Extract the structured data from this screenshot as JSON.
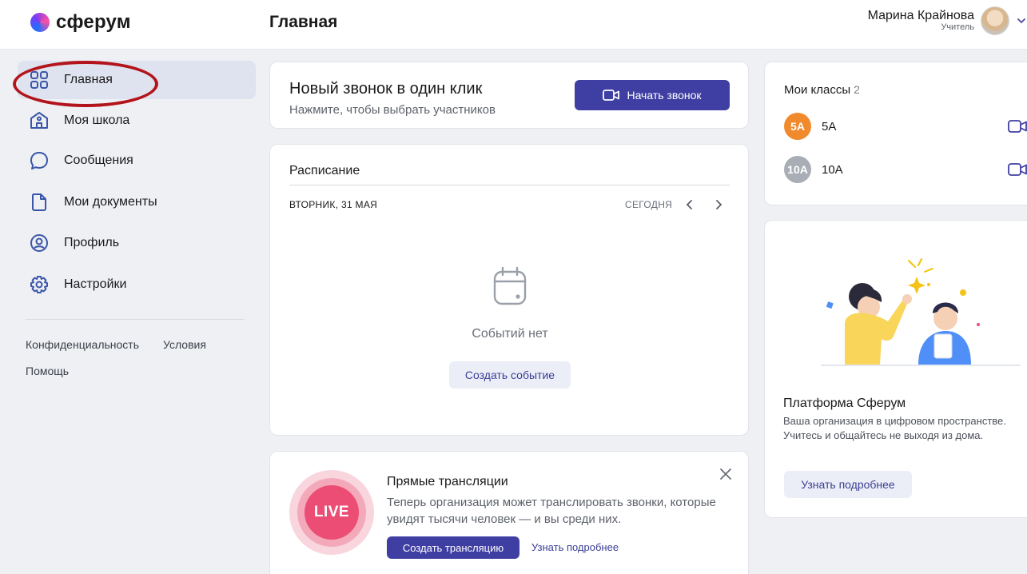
{
  "header": {
    "logo_text": "сферум",
    "page_title": "Главная",
    "user_name": "Марина Крайнова",
    "user_role": "Учитель"
  },
  "sidebar": {
    "items": [
      {
        "label": "Главная",
        "icon": "grid-icon",
        "active": true
      },
      {
        "label": "Моя школа",
        "icon": "school-icon",
        "active": false
      },
      {
        "label": "Сообщения",
        "icon": "chat-icon",
        "active": false
      },
      {
        "label": "Мои документы",
        "icon": "document-icon",
        "active": false
      },
      {
        "label": "Профиль",
        "icon": "profile-icon",
        "active": false
      },
      {
        "label": "Настройки",
        "icon": "gear-icon",
        "active": false
      }
    ],
    "footer_links": {
      "privacy": "Конфиденциальность",
      "terms": "Условия",
      "help": "Помощь"
    }
  },
  "call_card": {
    "title": "Новый звонок в один клик",
    "subtitle": "Нажмите, чтобы выбрать участников",
    "button_label": "Начать звонок"
  },
  "schedule": {
    "title": "Расписание",
    "date": "ВТОРНИК, 31 МАЯ",
    "today_label": "СЕГОДНЯ",
    "empty_text": "Событий нет",
    "create_label": "Создать событие"
  },
  "live": {
    "badge": "LIVE",
    "title": "Прямые трансляции",
    "text": "Теперь организация может транслировать звонки, которые увидят тысячи человек — и вы среди них.",
    "create_label": "Создать трансляцию",
    "more_label": "Узнать подробнее"
  },
  "classes": {
    "title": "Мои классы",
    "count": "2",
    "items": [
      {
        "badge": "5А",
        "name": "5А",
        "color": "#f08a2c"
      },
      {
        "badge": "10А",
        "name": "10А",
        "color": "#a9adb6"
      }
    ]
  },
  "promo": {
    "title": "Платформа Сферум",
    "text": "Ваша организация в цифровом пространстве. Учитесь и общайтесь не выходя из дома.",
    "button_label": "Узнать подробнее"
  },
  "colors": {
    "accent": "#3f3fa3",
    "live": "#ec4d74",
    "highlight_ring": "#b3141b"
  }
}
